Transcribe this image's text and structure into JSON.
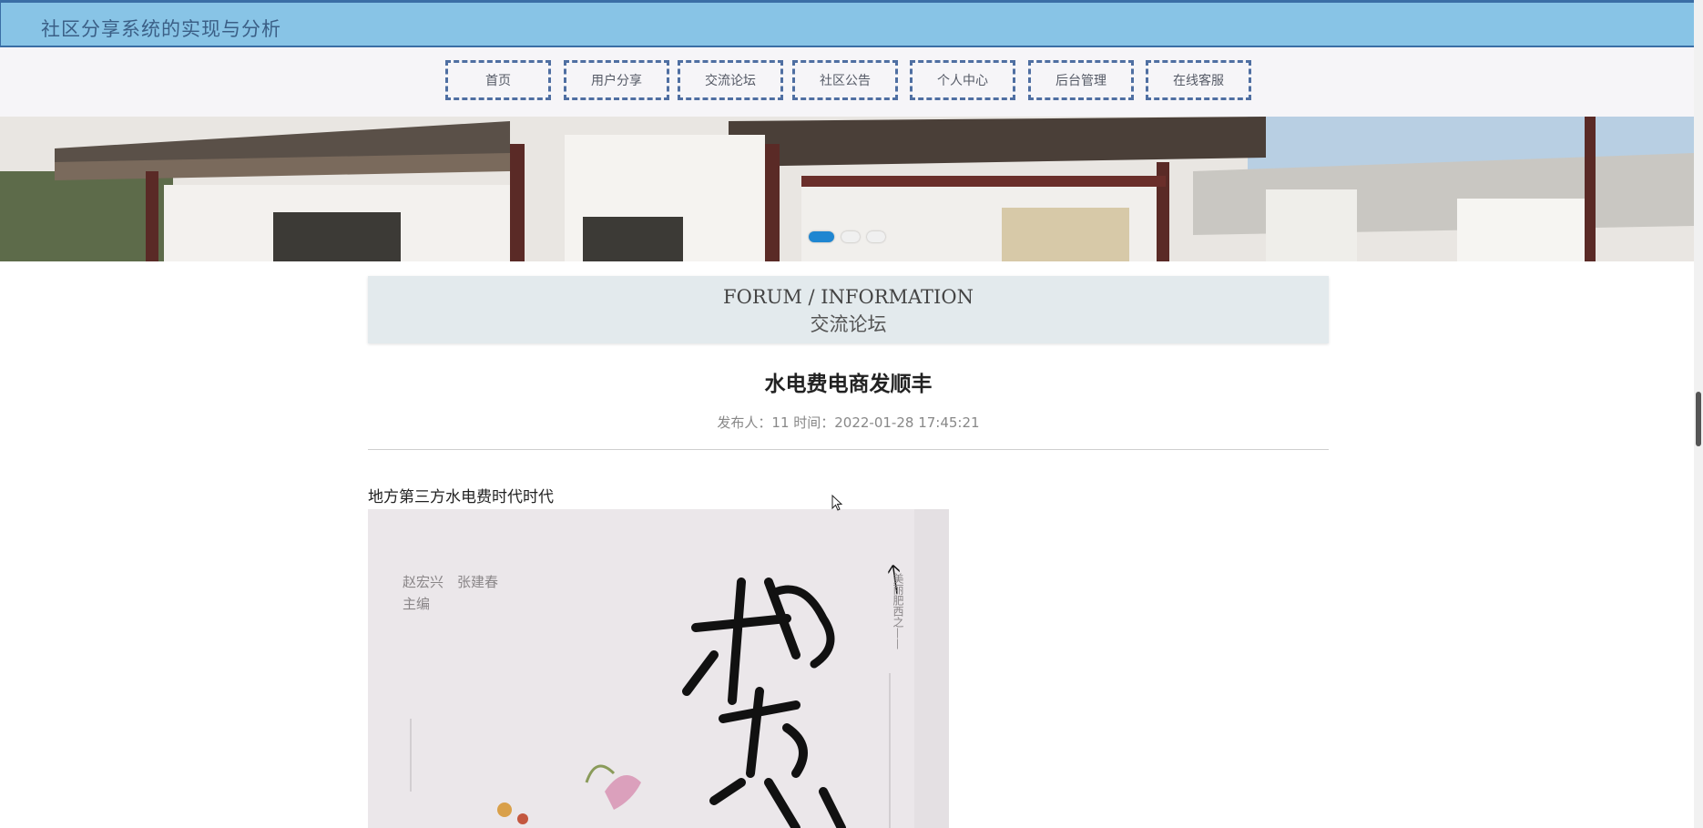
{
  "app": {
    "title": "社区分享系统的实现与分析"
  },
  "nav": {
    "items": [
      {
        "label": "首页",
        "name": "nav-home"
      },
      {
        "label": "用户分享",
        "name": "nav-user-share"
      },
      {
        "label": "交流论坛",
        "name": "nav-forum"
      },
      {
        "label": "社区公告",
        "name": "nav-notice"
      },
      {
        "label": "个人中心",
        "name": "nav-profile"
      },
      {
        "label": "后台管理",
        "name": "nav-admin"
      },
      {
        "label": "在线客服",
        "name": "nav-support"
      }
    ]
  },
  "banner": {
    "slides": 3,
    "active_index": 0
  },
  "section": {
    "title_en": "FORUM / INFORMATION",
    "title_zh": "交流论坛"
  },
  "post": {
    "title": "水电费电商发顺丰",
    "meta": "发布人：11 时间：2022-01-28 17:45:21",
    "body": "地方第三方水电费时代时代"
  },
  "book_cover": {
    "authors": "赵宏兴　张建春",
    "editor_label": "主编",
    "series": "美丽肥西之——"
  },
  "colors": {
    "header_bg": "#88c4e6",
    "header_text": "#3b5f86",
    "nav_border": "#4f6fa2",
    "dot_active": "#1f86d1"
  }
}
